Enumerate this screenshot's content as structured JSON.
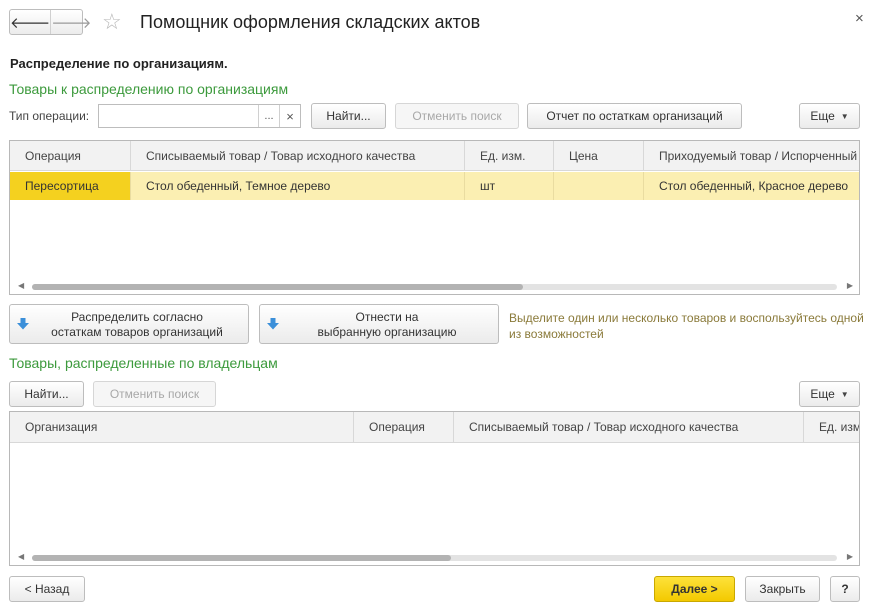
{
  "window": {
    "title": "Помощник оформления складских актов",
    "close_glyph": "×",
    "back_glyph": "🡐",
    "forward_glyph": "🡒",
    "star_glyph": "☆"
  },
  "section": {
    "label": "Распределение по организациям."
  },
  "top_group": {
    "title": "Товары к распределению по организациям",
    "operation_type_label": "Тип операции:",
    "operation_type_value": "",
    "select_glyph": "...",
    "clear_glyph": "×",
    "find_label": "Найти...",
    "cancel_search_label": "Отменить поиск",
    "report_label": "Отчет по остаткам организаций",
    "more_label": "Еще",
    "columns": [
      "Операция",
      "Списываемый товар / Товар исходного качества",
      "Ед. изм.",
      "Цена",
      "Приходуемый товар / Испорченный товар"
    ],
    "rows": [
      [
        "Пересортица",
        "Стол обеденный, Темное дерево",
        "шт",
        "",
        "Стол обеденный, Красное дерево"
      ]
    ],
    "scroll_fraction": 0.61
  },
  "actions": {
    "distribute_label_line1": "Распределить согласно",
    "distribute_label_line2": "остаткам товаров организаций",
    "assign_label_line1": "Отнести на",
    "assign_label_line2": "выбранную организацию",
    "hint_text": "Выделите один или несколько товаров и воспользуйтесь одной из возможностей"
  },
  "bottom_group": {
    "title": "Товары, распределенные по владельцам",
    "find_label": "Найти...",
    "cancel_search_label": "Отменить поиск",
    "more_label": "Еще",
    "columns": [
      "Организация",
      "Операция",
      "Списываемый товар / Товар исходного качества",
      "Ед. изм."
    ],
    "scroll_fraction": 0.52
  },
  "footer": {
    "back_label": "< Назад",
    "next_label": "Далее >",
    "close_label": "Закрыть",
    "help_label": "?"
  },
  "colors": {
    "accent_green": "#3c9a3c",
    "selected_row": "#fbefb2",
    "active_cell": "#f4d11f",
    "primary_button": "#f3c900"
  },
  "icons": {
    "distribute_icon": "arrow-down-icon",
    "assign_icon": "arrow-down-icon"
  }
}
